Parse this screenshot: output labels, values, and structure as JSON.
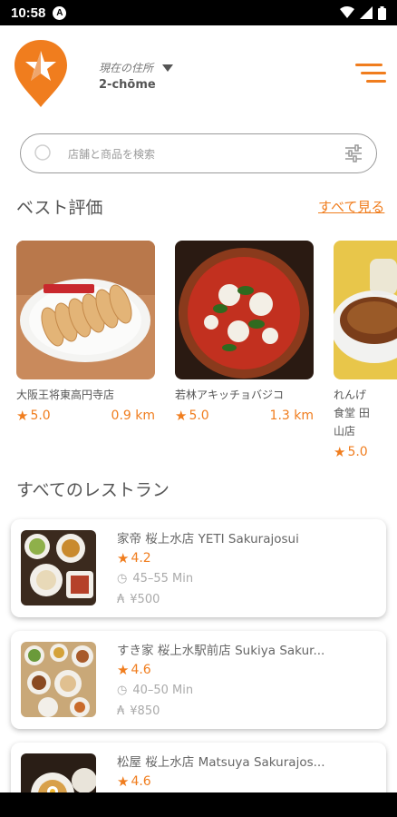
{
  "status_bar": {
    "time": "10:58",
    "notification_icon": "A"
  },
  "header": {
    "location_label": "現在の住所",
    "location_value": "2-chōme",
    "brand_color": "#f07d1e"
  },
  "search": {
    "placeholder": "店舗と商品を検索"
  },
  "best": {
    "title": "ベスト評価",
    "see_all": "すべて見る",
    "cards": [
      {
        "name": "大阪王将東高円寺店",
        "rating": "5.0",
        "distance": "0.9 km"
      },
      {
        "name": "若林アキッチョバジコ",
        "rating": "5.0",
        "distance": "1.3 km"
      },
      {
        "name": "れんげ食堂 田山店",
        "rating": "5.0",
        "distance": ""
      }
    ]
  },
  "all": {
    "title": "すべてのレストラン",
    "restaurants": [
      {
        "name": "家帝 桜上水店 YETI Sakurajosui",
        "rating": "4.2",
        "time": "45–55 Min",
        "price": "¥500"
      },
      {
        "name": "すき家 桜上水駅前店 Sukiya Sakur...",
        "rating": "4.6",
        "time": "40–50 Min",
        "price": "¥850"
      },
      {
        "name": "松屋 桜上水店 Matsuya Sakurajos...",
        "rating": "4.6",
        "time": "",
        "price": ""
      }
    ]
  }
}
